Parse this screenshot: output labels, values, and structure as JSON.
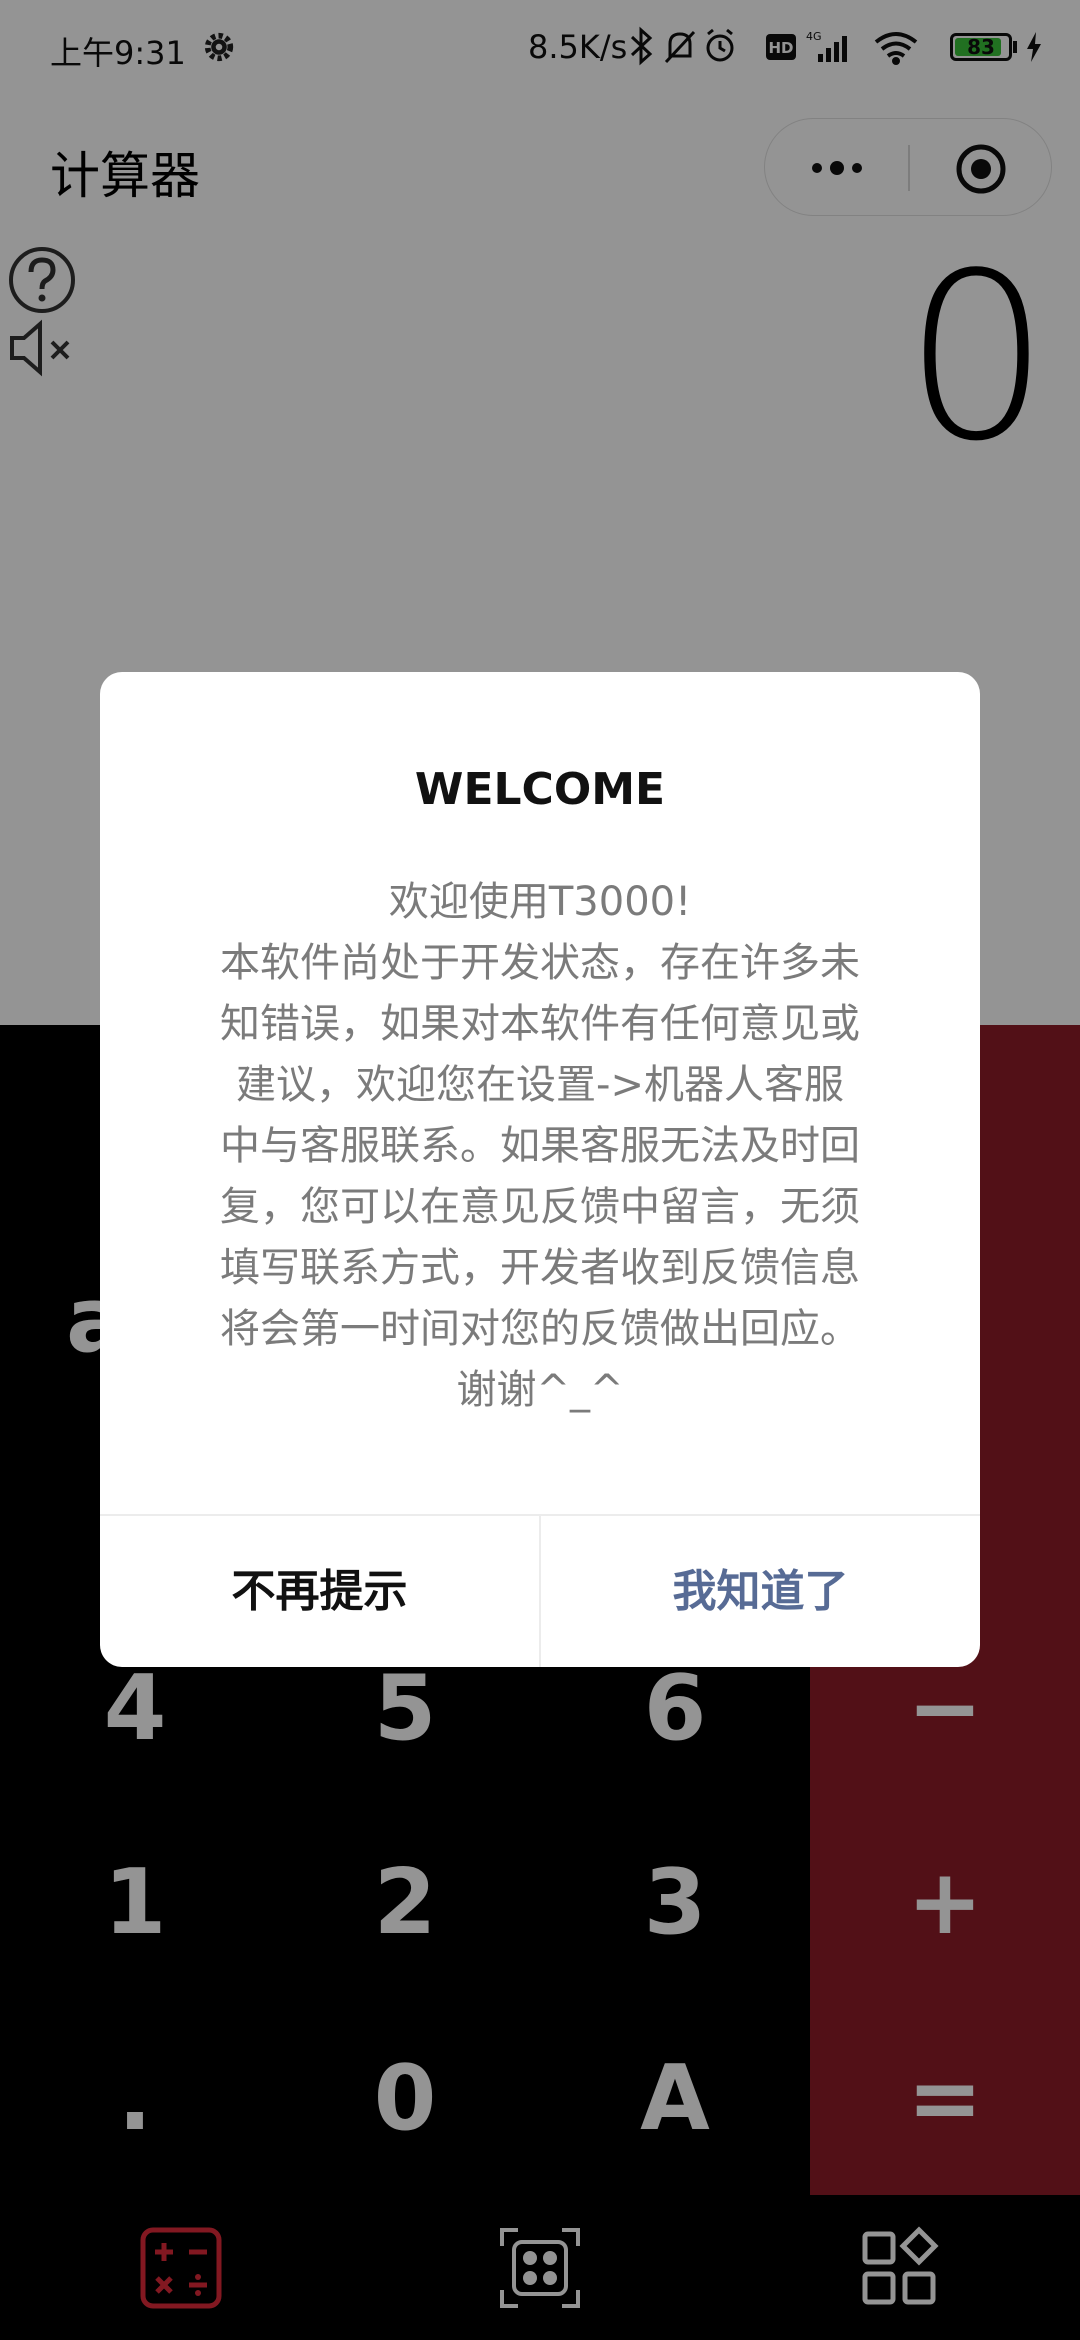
{
  "status_bar": {
    "time": "上午9:31",
    "network_speed": "8.5K/s",
    "battery_level": "83",
    "icons": [
      "settings-gear-icon",
      "bluetooth-icon",
      "silent-bell-icon",
      "alarm-icon",
      "hd-icon",
      "signal-4g-icon",
      "wifi-icon",
      "battery-icon",
      "charging-bolt-icon"
    ]
  },
  "header": {
    "title": "计算器",
    "capsule_icons": [
      "more-dots-icon",
      "close-target-icon"
    ]
  },
  "display": {
    "value": "0",
    "side_icons": [
      "help-icon",
      "mute-icon"
    ]
  },
  "keypad": {
    "partial_key": "a",
    "rows": [
      [
        "4",
        "5",
        "6",
        "−"
      ],
      [
        "1",
        "2",
        "3",
        "+"
      ],
      [
        ".",
        "0",
        "A",
        "="
      ]
    ]
  },
  "tabbar": {
    "icons": [
      "calculator-ops-icon",
      "apps-grid-icon",
      "more-apps-icon"
    ]
  },
  "dialog": {
    "title": "WELCOME",
    "lines": [
      "欢迎使用T3000!",
      "本软件尚处于开发状态，存在许多未",
      "知错误，如果对本软件有任何意见或",
      "建议，欢迎您在设置->机器人客服",
      "中与客服联系。如果客服无法及时回",
      "复，您可以在意见反馈中留言，无须",
      "填写联系方式，开发者收到反馈信息",
      "将会第一时间对您的反馈做出回应。",
      "谢谢^_^"
    ],
    "cancel_label": "不再提示",
    "confirm_label": "我知道了"
  },
  "colors": {
    "operator_column": "#8d1c28",
    "confirm_text": "#576b95",
    "battery_fill": "#3ac23a"
  }
}
